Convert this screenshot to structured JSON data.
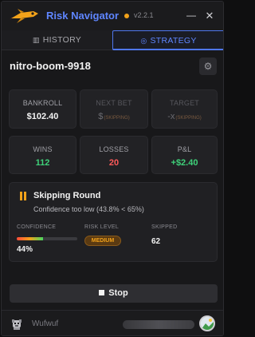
{
  "app": {
    "title": "Risk Navigator",
    "version": "v2.2.1",
    "status_color": "#f2a21a",
    "accent": "#5f86ff",
    "logo_icon": "rocket-plane-icon",
    "minimize_glyph": "—",
    "close_glyph": "✕"
  },
  "tabs": [
    {
      "label": "HISTORY",
      "icon": "bar-chart-icon",
      "icon_glyph": "▥",
      "active": false
    },
    {
      "label": "STRATEGY",
      "icon": "target-icon",
      "icon_glyph": "◎",
      "active": true
    }
  ],
  "session": {
    "name": "nitro-boom-9918",
    "settings_icon": "gear-icon",
    "settings_glyph": "⚙"
  },
  "stats": {
    "bankroll": {
      "label": "BANKROLL",
      "value": "$102.40"
    },
    "next_bet": {
      "label": "NEXT BET",
      "value": "$",
      "tag": "(SKIPPING)"
    },
    "target": {
      "label": "TARGET",
      "value": "-x",
      "tag": "(SKIPPING)"
    },
    "wins": {
      "label": "WINS",
      "value": "112"
    },
    "losses": {
      "label": "LOSSES",
      "value": "20"
    },
    "pnl": {
      "label": "P&L",
      "value": "+$2.40"
    }
  },
  "status": {
    "icon": "pause-icon",
    "title": "Skipping Round",
    "subtitle": "Confidence too low (43.8% < 65%)",
    "confidence_label": "CONFIDENCE",
    "confidence_value": "44%",
    "confidence_fraction": 0.44,
    "risk_label": "RISK LEVEL",
    "risk_value": "MEDIUM",
    "skipped_label": "SKIPPED",
    "skipped_value": "62"
  },
  "actions": {
    "stop_label": "Stop",
    "stop_icon": "stop-icon"
  },
  "footer": {
    "username": "Wufwuf",
    "avatar_icon": "dog-avatar-icon",
    "profile_icon": "profile-avatar-icon"
  }
}
